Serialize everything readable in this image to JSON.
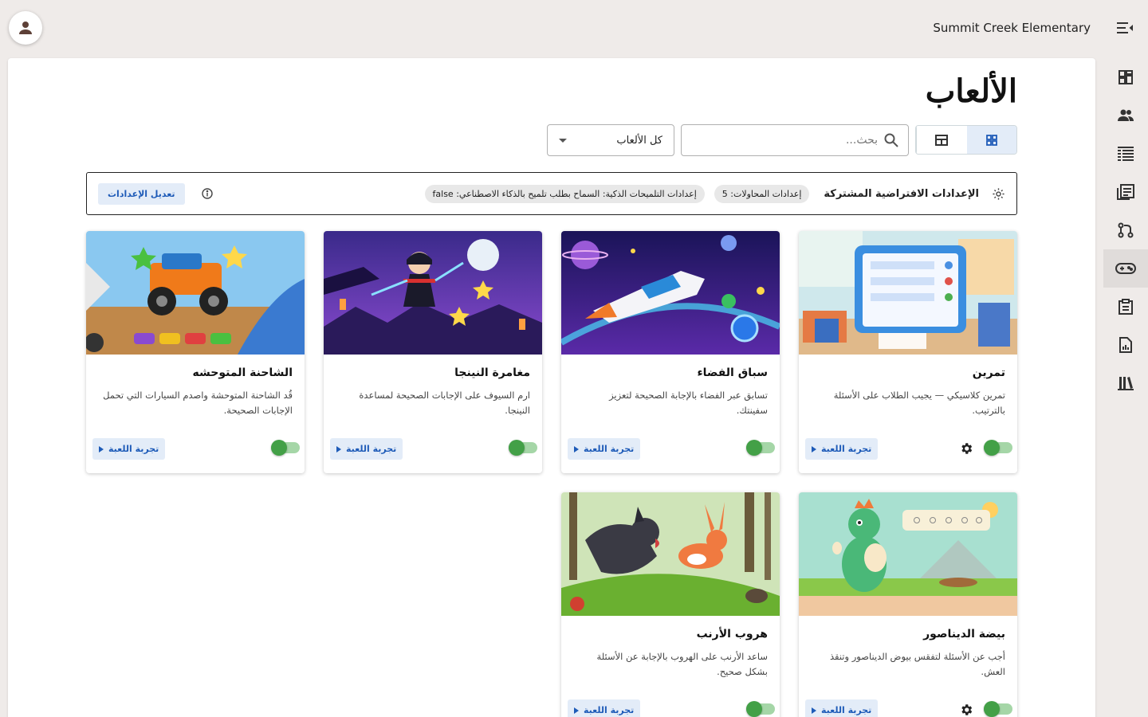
{
  "header": {
    "school_name": "Summit Creek Elementary"
  },
  "page": {
    "title": "الألعاب",
    "search_placeholder": "بحث...",
    "filter_value": "كل الألعاب"
  },
  "shared_settings": {
    "title": "الإعدادات الافتراضية المشتركة",
    "chips": [
      "إعدادات المحاولات: 5",
      "إعدادات التلميحات الذكية: السماح بطلب تلميح بالذكاء الاصطناعي: false"
    ],
    "edit_label": "تعديل الإعدادات"
  },
  "games": [
    {
      "name": "تمرين",
      "description": "تمرين كلاسيكي — يجيب الطلاب على الأسئلة بالترتيب.",
      "try_label": "تجربة اللعبة",
      "enabled": true,
      "has_settings": true
    },
    {
      "name": "سباق الفضاء",
      "description": "تسابق عبر الفضاء بالإجابة الصحيحة لتعزيز سفينتك.",
      "try_label": "تجربة اللعبة",
      "enabled": true,
      "has_settings": false
    },
    {
      "name": "مغامرة النينجا",
      "description": "ارم السيوف على الإجابات الصحيحة لمساعدة النينجا.",
      "try_label": "تجربة اللعبة",
      "enabled": true,
      "has_settings": false
    },
    {
      "name": "الشاحنة المتوحشه",
      "description": "قُد الشاحنة المتوحشة واصدم السيارات التي تحمل الإجابات الصحيحة.",
      "try_label": "تجربة اللعبة",
      "enabled": true,
      "has_settings": false
    },
    {
      "name": "بيضة الديناصور",
      "description": "أجب عن الأسئلة لتفقس بيوض الديناصور وتنقذ العش.",
      "try_label": "تجربة اللعبة",
      "enabled": true,
      "has_settings": true
    },
    {
      "name": "هروب الأرنب",
      "description": "ساعد الأرنب على الهروب بالإجابة عن الأسئلة بشكل صحيح.",
      "try_label": "تجربة اللعبة",
      "enabled": true,
      "has_settings": false
    }
  ],
  "colors": {
    "accent": "#1e5bb8",
    "toggle_on": "#43a047",
    "page_bg": "#efebe9"
  },
  "icons": {
    "rail": [
      "dashboard-icon",
      "people-icon",
      "list-icon",
      "article-icon",
      "route-icon",
      "gamepad-icon",
      "clipboard-icon",
      "report-icon",
      "library-icon"
    ]
  }
}
